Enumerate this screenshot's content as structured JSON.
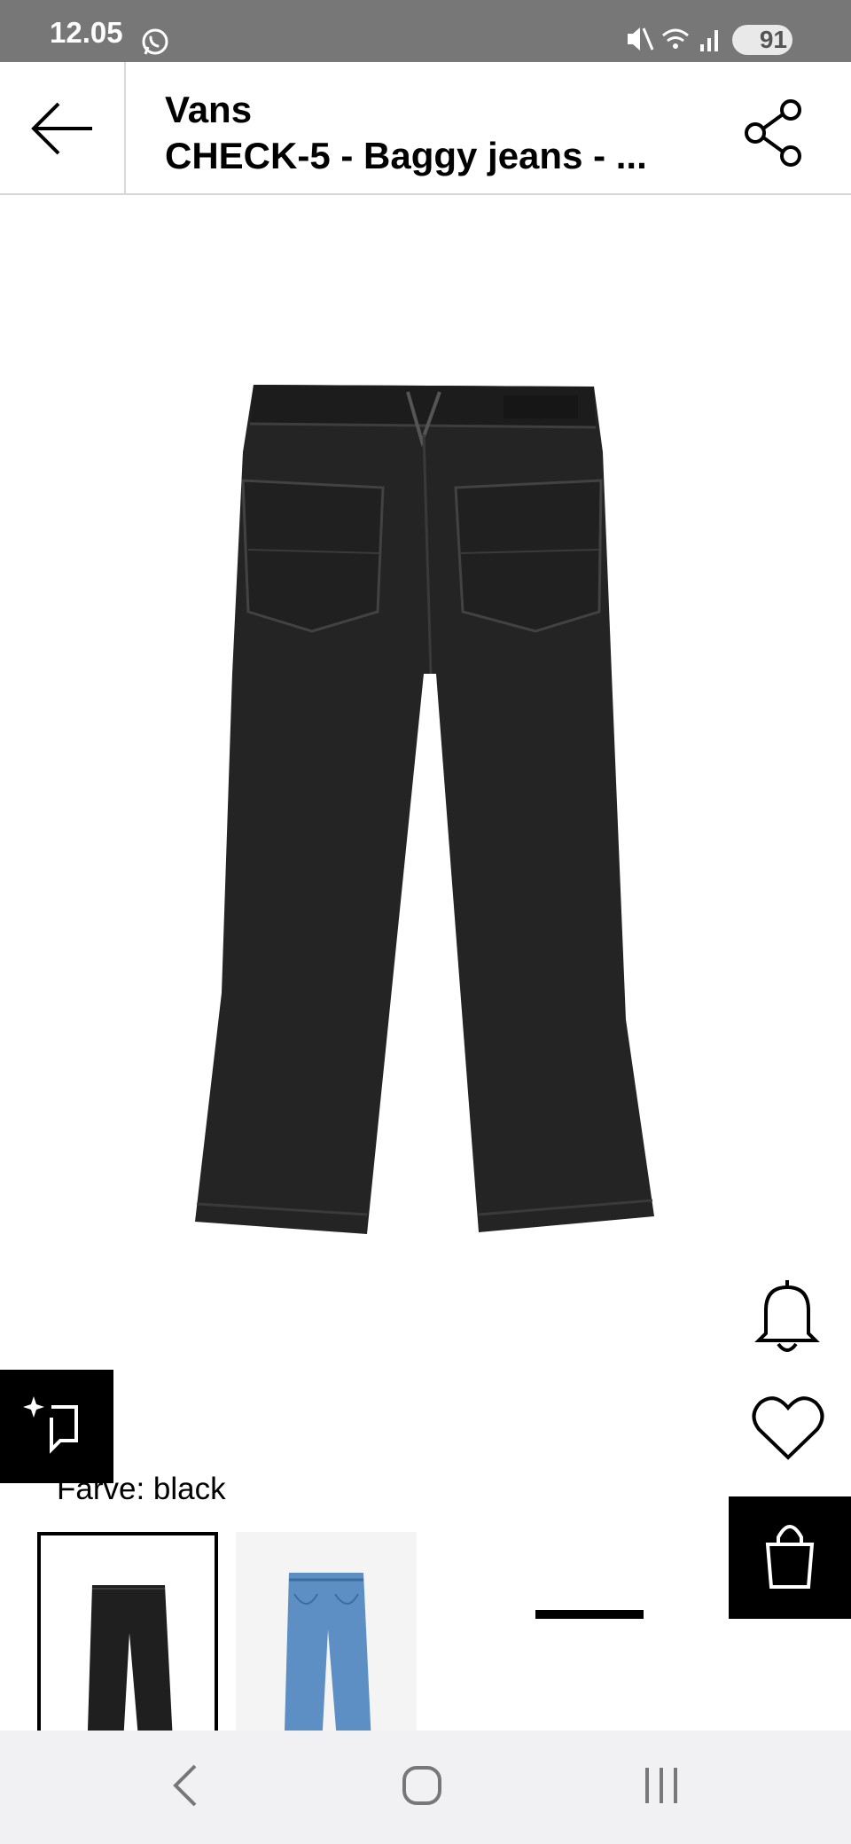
{
  "status_bar": {
    "time": "12.05",
    "battery": "91"
  },
  "header": {
    "brand": "Vans",
    "product_name": "CHECK-5  - Baggy jeans - ..."
  },
  "product": {
    "color_label": "Farve: black"
  },
  "icons": {
    "back": "arrow-left-icon",
    "share": "share-icon",
    "ai": "sparkle-shop-icon",
    "alert": "bell-icon",
    "wishlist": "heart-icon",
    "bag": "shopping-bag-icon"
  },
  "colors": {
    "background": "#ffffff",
    "status_bar": "#777777",
    "nav_bar": "#f1f1f3",
    "accent": "#000000"
  }
}
